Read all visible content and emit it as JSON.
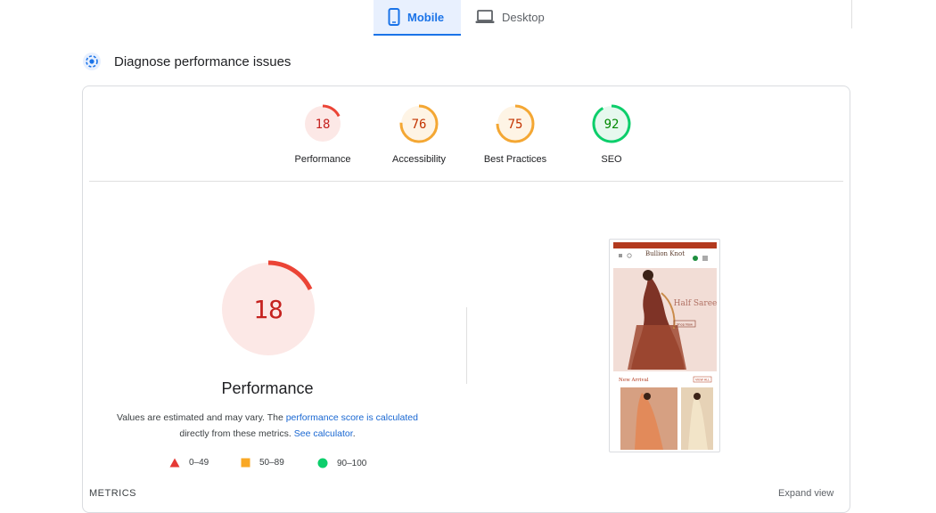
{
  "tabs": [
    {
      "label": "Mobile",
      "icon": "phone-icon",
      "active": true
    },
    {
      "label": "Desktop",
      "icon": "laptop-icon",
      "active": false
    }
  ],
  "diagnose": {
    "title": "Diagnose performance issues",
    "icon": "diagnose-icon"
  },
  "categories": [
    {
      "label": "Performance",
      "score": 18,
      "status": "fail"
    },
    {
      "label": "Accessibility",
      "score": 76,
      "status": "average"
    },
    {
      "label": "Best Practices",
      "score": 75,
      "status": "average"
    },
    {
      "label": "SEO",
      "score": 92,
      "status": "pass"
    }
  ],
  "main_gauge": {
    "score": 18,
    "label": "Performance"
  },
  "description": {
    "text_1": "Values are estimated and may vary. The ",
    "link_1": "performance score is calculated",
    "text_2": "directly from these metrics. ",
    "link_2": "See calculator",
    "text_3": "."
  },
  "legend": [
    {
      "range": "0–49",
      "shape": "triangle",
      "color": "#e53935"
    },
    {
      "range": "50–89",
      "shape": "square",
      "color": "#f9a825"
    },
    {
      "range": "90–100",
      "shape": "circle",
      "color": "#0cce6b"
    }
  ],
  "metrics_header": "METRICS",
  "expand_label": "Expand view",
  "screenshot": {
    "brand": "Bullion Knot",
    "promo_text": "Half Saree",
    "button": "Shop Now",
    "section": "New Arrival",
    "view_all": "VIEW ALL"
  },
  "colors": {
    "fail": "#eb4436",
    "fail_bg": "#fce8e6",
    "average": "#f4a733",
    "average_bg": "#fef4e5",
    "pass": "#0cce6b",
    "pass_bg": "#e6f8ee",
    "accent": "#1a73e8"
  }
}
